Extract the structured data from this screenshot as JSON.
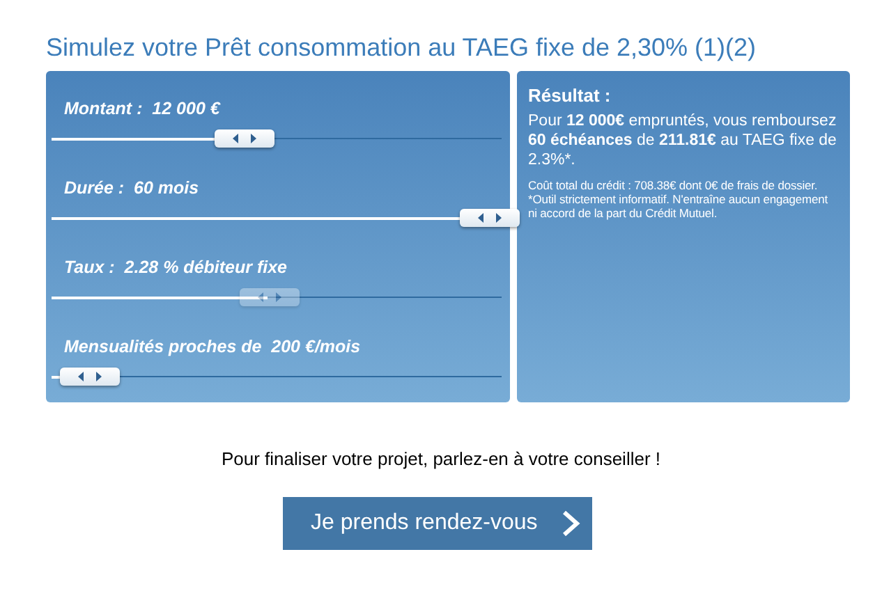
{
  "title": "Simulez votre Prêt consommation au TAEG fixe de 2,30% (1)(2)",
  "sliders": [
    {
      "label": "Montant :  12 000 €",
      "level": 0.4,
      "disabled": false
    },
    {
      "label": "Durée :  60 mois",
      "level": 1,
      "disabled": false
    },
    {
      "label": "Taux :  2.28 % débiteur fixe",
      "level": 0.46,
      "disabled": true
    },
    {
      "label": "Mensualités proches de  200 €/mois",
      "level": 0.02,
      "disabled": false
    }
  ],
  "result": {
    "heading": "Résultat :",
    "summary": "Pour **12 000€** empruntés, vous remboursez **60 échéances** de **211.81€** au TAEG fixe de 2.3%*.",
    "note": "Coût total du crédit : 708.38€ dont 0€ de frais de dossier. *Outil strictement informatif. N'entraîne aucun engagement ni accord de la part du Crédit Mutuel."
  },
  "cta_text": "Pour finaliser votre projet, parlez-en à votre conseiller !",
  "button": {
    "label": "Je prends rendez-vous"
  }
}
